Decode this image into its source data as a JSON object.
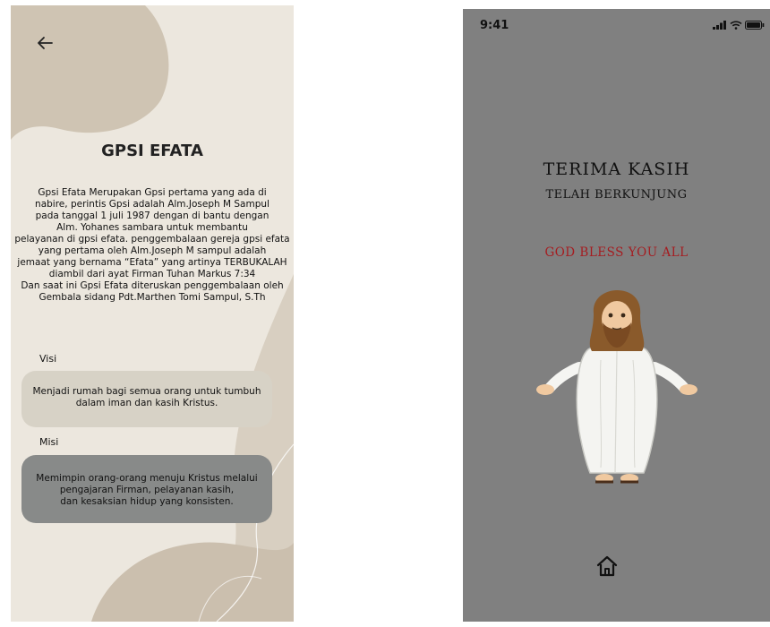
{
  "left_screen": {
    "title": "GPSI EFATA",
    "description_lines": [
      "Gpsi Efata Merupakan Gpsi pertama yang ada di",
      "nabire, perintis Gpsi adalah Alm.Joseph M Sampul",
      "pada tanggal 1 juli 1987 dengan di bantu dengan",
      "Alm. Yohanes sambara untuk membantu",
      "pelayanan di gpsi efata. penggembalaan gereja gpsi efata",
      "yang pertama oleh Alm.Joseph M sampul adalah",
      "jemaat yang bernama “Efata” yang artinya TERBUKALAH",
      "diambil dari ayat Firman Tuhan Markus 7:34",
      "Dan saat ini Gpsi Efata diteruskan penggembalaan oleh",
      "Gembala sidang Pdt.Marthen Tomi Sampul, S.Th"
    ],
    "visi_label": "Visi",
    "visi_lines": [
      "Menjadi rumah bagi semua orang untuk tumbuh",
      "dalam iman dan kasih Kristus."
    ],
    "misi_label": "Misi",
    "misi_lines": [
      "Memimpin orang-orang menuju Kristus melalui",
      "pengajaran Firman, pelayanan kasih,",
      "dan kesaksian hidup yang konsisten."
    ],
    "icons": {
      "back": "arrow-left-icon"
    },
    "colors": {
      "background": "#ece7de",
      "visi_card": "#d7d2c6",
      "misi_card": "#888a89"
    }
  },
  "right_screen": {
    "status_time": "9:41",
    "title": "TERIMA KASIH",
    "subtitle": "TELAH BERKUNJUNG",
    "blessing": "GOD BLESS YOU ALL",
    "icons": {
      "nav": "home-icon",
      "signal": "signal-icon",
      "wifi": "wifi-icon",
      "battery": "battery-icon",
      "illustration": "jesus-illustration"
    },
    "colors": {
      "background": "#808080",
      "blessing": "#a51c20"
    }
  }
}
